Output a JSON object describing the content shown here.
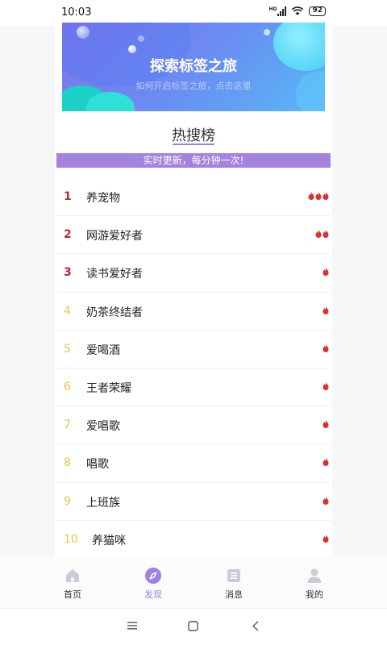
{
  "status": {
    "time": "10:03",
    "network": "HD",
    "battery": "92"
  },
  "banner": {
    "title": "探索标签之旅",
    "subtitle": "如何开启标签之旅，点击这里"
  },
  "hot": {
    "title": "热搜榜",
    "realtime_note": "实时更新，每分钟一次!",
    "items": [
      {
        "rank": "1",
        "label": "养宠物",
        "flames": 3
      },
      {
        "rank": "2",
        "label": "网游爱好者",
        "flames": 2
      },
      {
        "rank": "3",
        "label": "读书爱好者",
        "flames": 1
      },
      {
        "rank": "4",
        "label": "奶茶终结者",
        "flames": 1
      },
      {
        "rank": "5",
        "label": "爱喝酒",
        "flames": 1
      },
      {
        "rank": "6",
        "label": "王者荣耀",
        "flames": 1
      },
      {
        "rank": "7",
        "label": "爱唱歌",
        "flames": 1
      },
      {
        "rank": "8",
        "label": "唱歌",
        "flames": 1
      },
      {
        "rank": "9",
        "label": "上班族",
        "flames": 1
      },
      {
        "rank": "10",
        "label": "养猫咪",
        "flames": 1
      }
    ]
  },
  "nav": {
    "items": [
      {
        "label": "首页",
        "icon": "home-icon",
        "active": false
      },
      {
        "label": "发现",
        "icon": "compass-icon",
        "active": true
      },
      {
        "label": "消息",
        "icon": "message-icon",
        "active": false
      },
      {
        "label": "我的",
        "icon": "user-icon",
        "active": false
      }
    ]
  },
  "colors": {
    "accent": "#9b80e6",
    "top_rank": "#c8252c",
    "rank": "#e5c44c",
    "flame": "#d9322d"
  }
}
